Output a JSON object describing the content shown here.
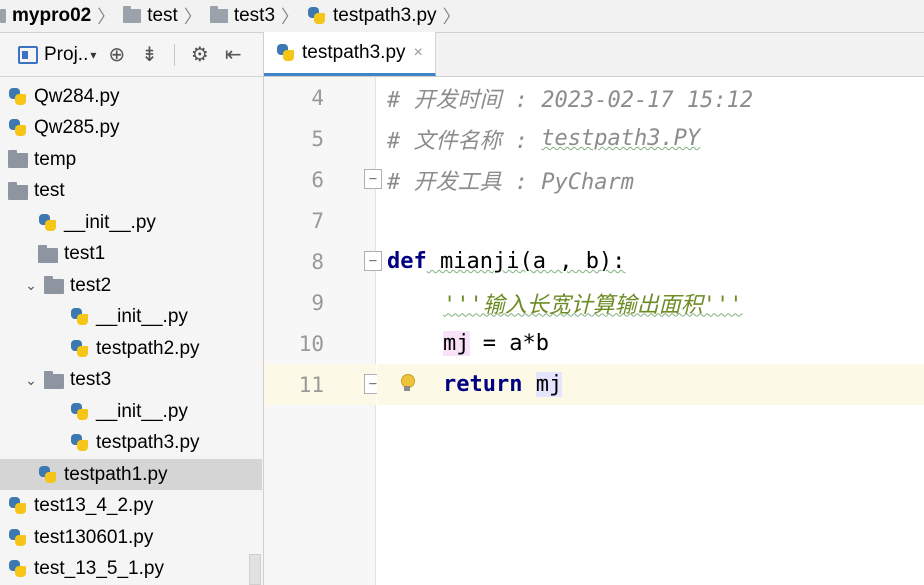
{
  "breadcrumb": {
    "project": "mypro02",
    "items": [
      "test",
      "test3",
      "testpath3.py"
    ]
  },
  "project_panel": {
    "view_label": "Proj..",
    "toolbar_icons": [
      "project-view-icon",
      "locate-icon",
      "collapse-all-icon",
      "gear-icon",
      "hide-panel-icon"
    ],
    "tree": [
      {
        "label": "Qw284.py",
        "type": "py",
        "depth": 0
      },
      {
        "label": "Qw285.py",
        "type": "py",
        "depth": 0
      },
      {
        "label": "temp",
        "type": "folder",
        "depth": 0
      },
      {
        "label": "test",
        "type": "folder",
        "depth": 0
      },
      {
        "label": "__init__.py",
        "type": "py",
        "depth": 1
      },
      {
        "label": "test1",
        "type": "folder",
        "depth": 1
      },
      {
        "label": "test2",
        "type": "folder",
        "depth": 1,
        "expanded": true
      },
      {
        "label": "__init__.py",
        "type": "py",
        "depth": 2
      },
      {
        "label": "testpath2.py",
        "type": "py",
        "depth": 2
      },
      {
        "label": "test3",
        "type": "folder",
        "depth": 1,
        "expanded": true
      },
      {
        "label": "__init__.py",
        "type": "py",
        "depth": 2
      },
      {
        "label": "testpath3.py",
        "type": "py",
        "depth": 2
      },
      {
        "label": "testpath1.py",
        "type": "py",
        "depth": 1,
        "selected": true
      },
      {
        "label": "test13_4_2.py",
        "type": "py",
        "depth": 0
      },
      {
        "label": "test130601.py",
        "type": "py",
        "depth": 0
      },
      {
        "label": "test_13_5_1.py",
        "type": "py",
        "depth": 0
      }
    ]
  },
  "editor": {
    "tab_label": "testpath3.py",
    "tab_close": "×",
    "lines": [
      {
        "num": "4",
        "text": "# 开发时间 : 2023-02-17 15:12"
      },
      {
        "num": "5",
        "text": "# 文件名称 : ",
        "extra": "testpath3.PY"
      },
      {
        "num": "6",
        "text": "# 开发工具 : PyCharm"
      },
      {
        "num": "7",
        "text": ""
      },
      {
        "num": "8",
        "kw": "def",
        "text": " mianji(a , b):"
      },
      {
        "num": "9",
        "text": "'''输入长宽计算输出面积'''"
      },
      {
        "num": "10",
        "var": "mj",
        "text": " = a*b"
      },
      {
        "num": "11",
        "kw": "return",
        "var": "mj"
      }
    ]
  },
  "colors": {
    "comment": "#8c8c8c",
    "keyword": "#000080",
    "docstring": "#6d8c26",
    "current_line": "#fcfae6",
    "tab_underline": "#4083c9"
  }
}
